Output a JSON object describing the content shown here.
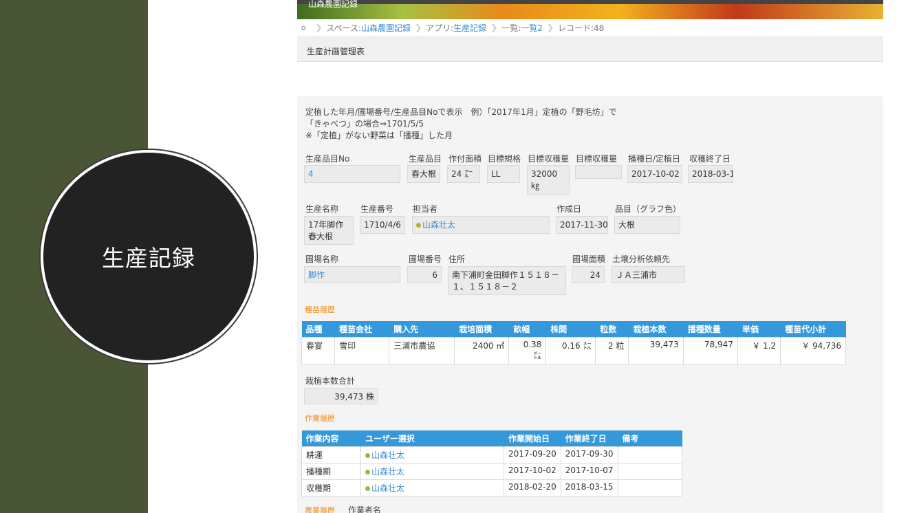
{
  "slide": {
    "title": "生産記録"
  },
  "banner": {
    "title": "山森農園記録"
  },
  "breadcrumb": {
    "space_prefix": "スペース:",
    "space": "山森農園記録",
    "app_prefix": "アプリ:",
    "app": "生産記録",
    "list_prefix": "一覧:",
    "list": "一覧2",
    "record": "レコード:48"
  },
  "page_title": "生産計画管理表",
  "note": {
    "line1": "定植した年月/圃場番号/生産品目Noで表示　例）「2017年1月」定植の「野毛坊」で",
    "line2": "「きゃべつ」の場合⇒1701/5/5",
    "line3": "※「定植」がない野菜は「播種」した月"
  },
  "row1": {
    "labels": [
      "生産品目No",
      "生産品目",
      "作付面積",
      "目標規格",
      "目標収穫量",
      "目標収穫量",
      "播種日/定植日",
      "収穫終了日"
    ],
    "no": "4",
    "item": "春大根",
    "area": "24 ㌃",
    "spec": "LL",
    "target_qty": "32000 ㎏",
    "target_qty2": "",
    "sow_date": "2017-10-02",
    "harvest_end": "2018-03-1"
  },
  "row2": {
    "labels": [
      "生産名称",
      "生産番号",
      "担当者",
      "作成日",
      "品目（グラフ色）"
    ],
    "name": "17年脚作 春大根",
    "number": "1710/4/6",
    "person": "山森壮太",
    "created": "2017-11-30",
    "color_item": "大根"
  },
  "row3": {
    "labels": [
      "圃場名称",
      "圃場番号",
      "住所",
      "圃場面積",
      "土壌分析依頼先"
    ],
    "field_name": "脚作",
    "field_no": "6",
    "address": "南下浦町金田脚作１５１８－１、１５１８－２",
    "field_area": "24",
    "soil": "ＪＡ三浦市"
  },
  "seed_section": {
    "title": "種苗履歴"
  },
  "seed_table": {
    "headers": [
      "品種",
      "種苗会社",
      "購入先",
      "栽培面積",
      "畝幅",
      "株間",
      "粒数",
      "栽植本数",
      "播種数量",
      "単価",
      "種苗代小計"
    ],
    "rows": [
      [
        "春宴",
        "雪印",
        "三浦市農協",
        "2400 ㎡",
        "0.38 ㍍",
        "0.16 ㍍",
        "2 粒",
        "39,473",
        "78,947",
        "￥ 1.2",
        "￥ 94,736"
      ]
    ]
  },
  "total": {
    "label": "栽植本数合計",
    "value": "39,473 株"
  },
  "work_section": {
    "title": "作業履歴"
  },
  "work_table": {
    "headers": [
      "作業内容",
      "ユーザー選択",
      "作業開始日",
      "作業終了日",
      "備考"
    ],
    "rows": [
      [
        "耕運",
        "山森壮太",
        "2017-09-20",
        "2017-09-30",
        ""
      ],
      [
        "播種期",
        "山森壮太",
        "2017-10-02",
        "2017-10-07",
        ""
      ],
      [
        "収穫期",
        "山森壮太",
        "2018-02-20",
        "2018-03-15",
        ""
      ]
    ]
  },
  "footer_section": {
    "title": "農薬履歴",
    "label": "作業者名"
  }
}
